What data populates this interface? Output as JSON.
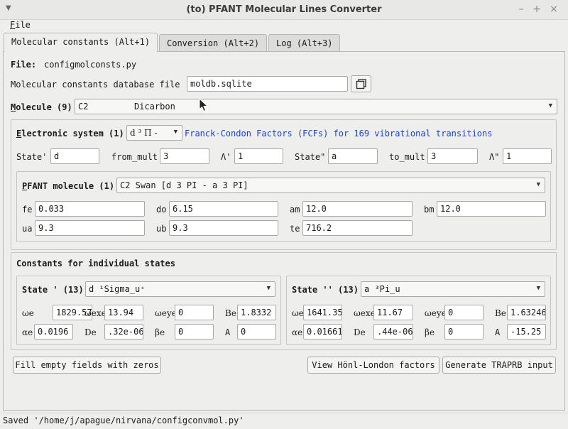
{
  "window": {
    "title": "(to) PFANT Molecular Lines Converter",
    "menu_icon": "chevron-down-icon",
    "minimize": "–",
    "maximize": "+",
    "close": "×"
  },
  "menubar": {
    "file": "File"
  },
  "tabs": [
    {
      "label": "Molecular constants (Alt+1)",
      "active": true
    },
    {
      "label": "Conversion (Alt+2)"
    },
    {
      "label": "Log (Alt+3)"
    }
  ],
  "file": {
    "label": "File:",
    "value": "configmolconsts.py"
  },
  "database": {
    "label": "Molecular constants database file",
    "value": "moldb.sqlite",
    "open_icon": "folder-open-icon"
  },
  "molecule": {
    "label": "Molecule (9)",
    "formula": "C2",
    "name": "Dicarbon"
  },
  "electronic": {
    "label": "Electronic system (1)",
    "selected": "d ³ Π -",
    "fcf_link": "Franck-Condon Factors (FCFs) for 169 vibrational transitions",
    "state1_label": "State'",
    "state1_value": "d",
    "from_mult_label": "from_mult",
    "from_mult_value": "3",
    "lambda1_label": "Λ'",
    "lambda1_value": "1",
    "state2_label": "State\"",
    "state2_value": "a",
    "to_mult_label": "to_mult",
    "to_mult_value": "3",
    "lambda2_label": "Λ\"",
    "lambda2_value": "1"
  },
  "pfant": {
    "label": "PFANT molecule (1)",
    "selected": "C2 Swan [d 3 PI - a 3 PI]",
    "fe_label": "fe",
    "fe": "0.033",
    "do_label": "do",
    "do": "6.15",
    "am_label": "am",
    "am": "12.0",
    "bm_label": "bm",
    "bm": "12.0",
    "ua_label": "ua",
    "ua": "9.3",
    "ub_label": "ub",
    "ub": "9.3",
    "te_label": "te",
    "te": "716.2"
  },
  "constants": {
    "title": "Constants for individual states",
    "state1": {
      "label": "State ' (13)",
      "selected": "d ¹Sigma_u⁺",
      "we": "1829.57",
      "wexe": "13.94",
      "weye": "0",
      "Be": "1.8332",
      "ae": "0.0196",
      "De": ".32e-06",
      "be": "0",
      "A": "0"
    },
    "state2": {
      "label": "State '' (13)",
      "selected": "a ³Pi_u",
      "we": "1641.35",
      "wexe": "11.67",
      "weye": "0",
      "Be": "1.63246",
      "ae": "0.01661",
      "De": ".44e-06",
      "be": "0",
      "A": "-15.25"
    }
  },
  "symbols": {
    "we": "ωe",
    "wexe": "ωexe",
    "weye": "ωeye",
    "Be": "Be",
    "ae": "αe",
    "De": "De",
    "be": "βe",
    "A": "A"
  },
  "buttons": {
    "fill_zeros": "Fill empty fields with zeros",
    "honl_london": "View Hönl-London factors",
    "traprb": "Generate TRAPRB input"
  },
  "status": "Saved '/home/j/apague/nirvana/configconvmol.py'"
}
